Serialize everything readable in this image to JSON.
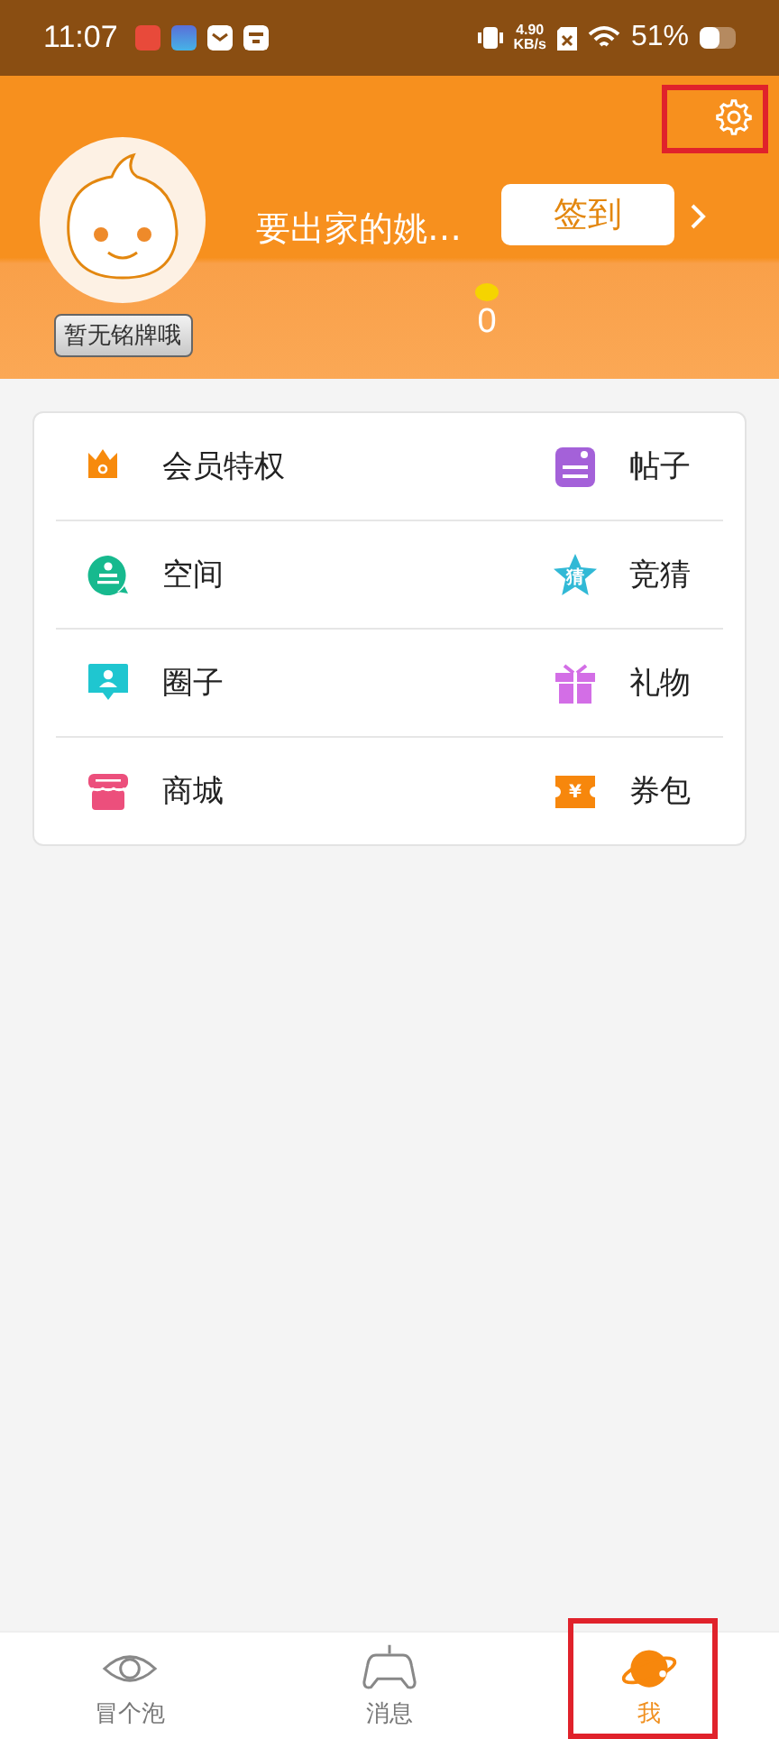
{
  "status_bar": {
    "time": "11:07",
    "speed_value": "4.90",
    "speed_unit": "KB/s",
    "battery": "51%"
  },
  "profile": {
    "settings": {
      "highlighted": true
    },
    "name": "要出家的姚…",
    "sign_in": "签到",
    "nameplate": "暂无铭牌哦",
    "beans": "0"
  },
  "menu": [
    {
      "kind": "crown",
      "label": "会员特权"
    },
    {
      "kind": "post",
      "label": "帖子"
    },
    {
      "kind": "space",
      "label": "空间"
    },
    {
      "kind": "star",
      "label": "竞猜",
      "icon_text": "猜"
    },
    {
      "kind": "person",
      "label": "圈子"
    },
    {
      "kind": "gift",
      "label": "礼物"
    },
    {
      "kind": "shop",
      "label": "商城"
    },
    {
      "kind": "ticket",
      "label": "券包",
      "icon_text": "¥"
    }
  ],
  "tabs": [
    {
      "kind": "eye",
      "label": "冒个泡",
      "selected": false,
      "highlighted": false
    },
    {
      "kind": "gamepad",
      "label": "消息",
      "selected": false,
      "highlighted": false
    },
    {
      "kind": "planet",
      "label": "我",
      "selected": true,
      "highlighted": true
    }
  ]
}
